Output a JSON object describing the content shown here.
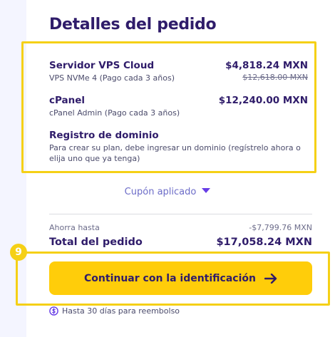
{
  "order": {
    "title": "Detalles del pedido",
    "items": [
      {
        "name": "Servidor VPS Cloud",
        "sub": "VPS NVMe 4 (Pago cada 3 años)",
        "price": "$4,818.24 MXN",
        "old_price": "$12,618.00 MXN"
      },
      {
        "name": "cPanel",
        "sub": "cPanel Admin (Pago cada 3 años)",
        "price": "$12,240.00 MXN"
      },
      {
        "name": "Registro de dominio",
        "sub": "Para crear su plan, debe ingresar un dominio (regístrelo ahora o elija uno que ya tenga)"
      }
    ],
    "coupon_label": "Cupón aplicado",
    "savings_label": "Ahorra hasta",
    "savings_value": "-$7,799.76 MXN",
    "total_label": "Total del pedido",
    "total_value": "$17,058.24 MXN",
    "step_badge": "9",
    "cta_label": "Continuar con la identificación",
    "refund_text": "Hasta 30 días para reembolso"
  },
  "icons": {
    "coupon_toggle": "caret-down-icon",
    "cta_arrow": "arrow-right-icon",
    "refund": "refund-icon"
  },
  "colors": {
    "text": "#2f1c6a",
    "accent": "#673de6",
    "button": "#ffcd0a",
    "highlight": "#f5d016"
  }
}
